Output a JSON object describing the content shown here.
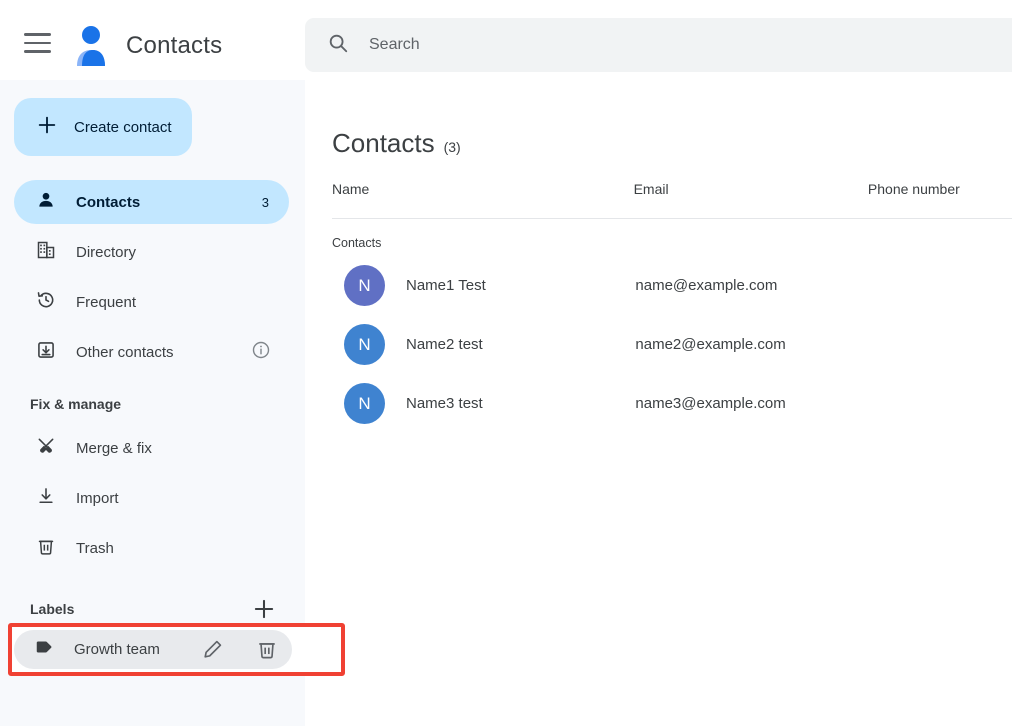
{
  "app": {
    "title": "Contacts",
    "logo_icon": "contacts-person-logo"
  },
  "topbar": {
    "menu_icon": "hamburger-menu-icon",
    "search": {
      "icon": "search-icon",
      "placeholder": "Search",
      "value": ""
    }
  },
  "sidebar": {
    "create_button": {
      "label": "Create contact",
      "icon": "plus-icon"
    },
    "nav_items": [
      {
        "label": "Contacts",
        "icon": "person-icon",
        "count": "3",
        "selected": true
      },
      {
        "label": "Directory",
        "icon": "building-icon",
        "count": "",
        "selected": false
      },
      {
        "label": "Frequent",
        "icon": "history-clock-icon",
        "count": "",
        "selected": false
      },
      {
        "label": "Other contacts",
        "icon": "download-box-icon",
        "count": "",
        "selected": false,
        "info_icon": "info-icon"
      }
    ],
    "fix_manage": {
      "title": "Fix & manage",
      "items": [
        {
          "label": "Merge & fix",
          "icon": "merge-tools-icon"
        },
        {
          "label": "Import",
          "icon": "import-download-icon"
        },
        {
          "label": "Trash",
          "icon": "trash-icon"
        }
      ]
    },
    "labels": {
      "title": "Labels",
      "add_icon": "plus-icon",
      "items": [
        {
          "name": "Growth team",
          "tag_icon": "label-tag-icon",
          "edit_icon": "pencil-edit-icon",
          "delete_icon": "trash-delete-icon",
          "highlighted": true
        }
      ]
    }
  },
  "main": {
    "title": "Contacts",
    "count": "(3)",
    "columns": [
      "Name",
      "Email",
      "Phone number"
    ],
    "group_label": "Contacts",
    "rows": [
      {
        "initial": "N",
        "avatar_color": "#6070c4",
        "name": "Name1 Test",
        "email": "name@example.com",
        "phone": ""
      },
      {
        "initial": "N",
        "avatar_color": "#3f83d0",
        "name": "Name2 test",
        "email": "name2@example.com",
        "phone": ""
      },
      {
        "initial": "N",
        "avatar_color": "#3f83d0",
        "name": "Name3 test",
        "email": "name3@example.com",
        "phone": ""
      }
    ]
  },
  "annotation": {
    "highlight_color": "#f04133"
  }
}
